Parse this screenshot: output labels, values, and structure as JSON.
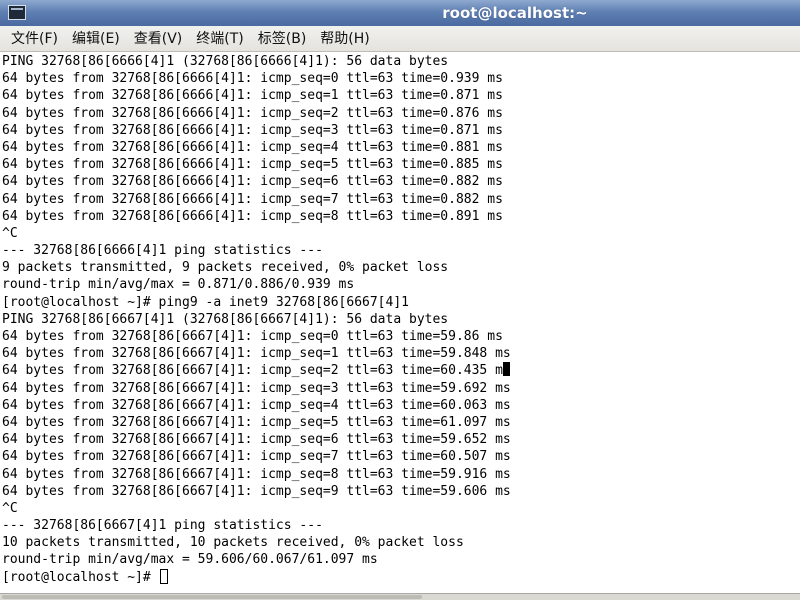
{
  "window": {
    "title": "root@localhost:~"
  },
  "menu": [
    {
      "label": "文件(F)",
      "name": "menu-file"
    },
    {
      "label": "编辑(E)",
      "name": "menu-edit"
    },
    {
      "label": "查看(V)",
      "name": "menu-view"
    },
    {
      "label": "终端(T)",
      "name": "menu-terminal"
    },
    {
      "label": "标签(B)",
      "name": "menu-tabs"
    },
    {
      "label": "帮助(H)",
      "name": "menu-help"
    }
  ],
  "terminal": {
    "lines": [
      "PING 32768[86[6666[4]1 (32768[86[6666[4]1): 56 data bytes",
      "64 bytes from 32768[86[6666[4]1: icmp_seq=0 ttl=63 time=0.939 ms",
      "64 bytes from 32768[86[6666[4]1: icmp_seq=1 ttl=63 time=0.871 ms",
      "64 bytes from 32768[86[6666[4]1: icmp_seq=2 ttl=63 time=0.876 ms",
      "64 bytes from 32768[86[6666[4]1: icmp_seq=3 ttl=63 time=0.871 ms",
      "64 bytes from 32768[86[6666[4]1: icmp_seq=4 ttl=63 time=0.881 ms",
      "64 bytes from 32768[86[6666[4]1: icmp_seq=5 ttl=63 time=0.885 ms",
      "64 bytes from 32768[86[6666[4]1: icmp_seq=6 ttl=63 time=0.882 ms",
      "64 bytes from 32768[86[6666[4]1: icmp_seq=7 ttl=63 time=0.882 ms",
      "64 bytes from 32768[86[6666[4]1: icmp_seq=8 ttl=63 time=0.891 ms",
      "^C",
      "--- 32768[86[6666[4]1 ping statistics ---",
      "9 packets transmitted, 9 packets received, 0% packet loss",
      "round-trip min/avg/max = 0.871/0.886/0.939 ms",
      "[root@localhost ~]# ping9 -a inet9 32768[86[6667[4]1",
      "PING 32768[86[6667[4]1 (32768[86[6667[4]1): 56 data bytes",
      "64 bytes from 32768[86[6667[4]1: icmp_seq=0 ttl=63 time=59.86 ms",
      "64 bytes from 32768[86[6667[4]1: icmp_seq=1 ttl=63 time=59.848 ms",
      "64 bytes from 32768[86[6667[4]1: icmp_seq=2 ttl=63 time=60.435 m",
      "64 bytes from 32768[86[6667[4]1: icmp_seq=3 ttl=63 time=59.692 ms",
      "64 bytes from 32768[86[6667[4]1: icmp_seq=4 ttl=63 time=60.063 ms",
      "64 bytes from 32768[86[6667[4]1: icmp_seq=5 ttl=63 time=61.097 ms",
      "64 bytes from 32768[86[6667[4]1: icmp_seq=6 ttl=63 time=59.652 ms",
      "64 bytes from 32768[86[6667[4]1: icmp_seq=7 ttl=63 time=60.507 ms",
      "64 bytes from 32768[86[6667[4]1: icmp_seq=8 ttl=63 time=59.916 ms",
      "64 bytes from 32768[86[6667[4]1: icmp_seq=9 ttl=63 time=59.606 ms",
      "^C",
      "--- 32768[86[6667[4]1 ping statistics ---",
      "10 packets transmitted, 10 packets received, 0% packet loss",
      "round-trip min/avg/max = 59.606/60.067/61.097 ms",
      "[root@localhost ~]# "
    ],
    "block_cursor_line": 18,
    "prompt_cursor_line": 30
  },
  "colors": {
    "titlebar": "#5f80b3",
    "title_text": "#ffffff",
    "terminal_bg": "#ffffff",
    "terminal_fg": "#000000"
  },
  "icons": {
    "app": "terminal-icon"
  }
}
